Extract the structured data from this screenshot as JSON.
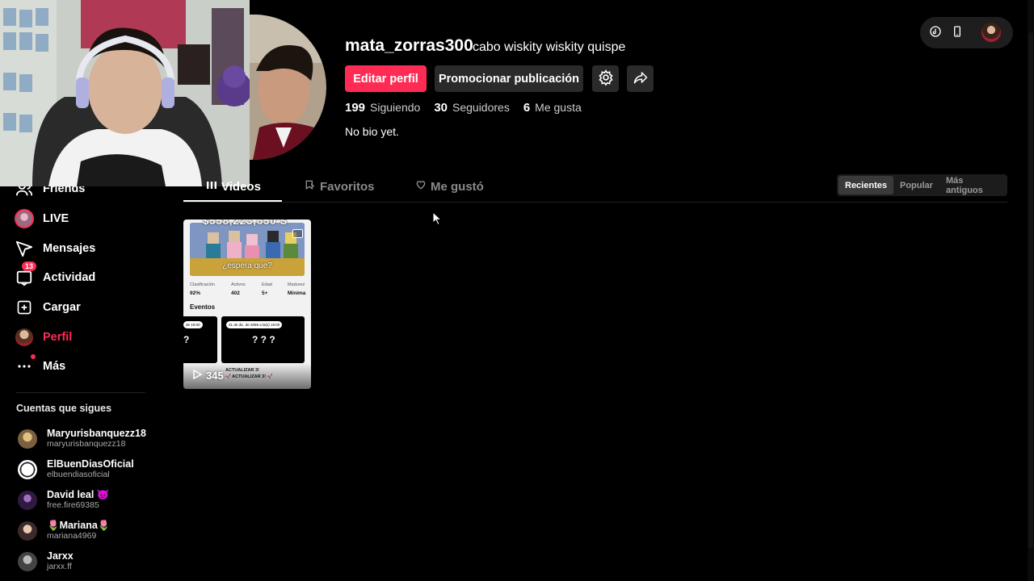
{
  "sidebar": {
    "items": [
      {
        "label": "Friends",
        "icon": "friends-icon"
      },
      {
        "label": "LIVE",
        "icon": "live-icon"
      },
      {
        "label": "Mensajes",
        "icon": "messages-icon"
      },
      {
        "label": "Actividad",
        "icon": "activity-icon",
        "badge": "13"
      },
      {
        "label": "Cargar",
        "icon": "upload-icon"
      },
      {
        "label": "Perfil",
        "icon": "profile-avatar-icon",
        "active": true
      },
      {
        "label": "Más",
        "icon": "more-icon"
      }
    ],
    "following_title": "Cuentas que sigues",
    "following": [
      {
        "name": "Maryurisbanquezz18",
        "handle": "maryurisbanquezz18"
      },
      {
        "name": "ElBuenDiasOficial",
        "handle": "elbuendiasoficial"
      },
      {
        "name": "David leal 👿",
        "handle": "free.fire69385"
      },
      {
        "name": "🌷Mariana🌷",
        "handle": "mariana4969"
      },
      {
        "name": "Jarxx",
        "handle": "jarxx.ff"
      }
    ]
  },
  "profile": {
    "username": "mata_zorras300",
    "nickname": "cabo wiskity wiskity quispe",
    "edit_label": "Editar perfil",
    "promote_label": "Promocionar publicación",
    "stats": {
      "following_count": "199",
      "following_label": "Siguiendo",
      "followers_count": "30",
      "followers_label": "Seguidores",
      "likes_count": "6",
      "likes_label": "Me gusta"
    },
    "bio": "No bio yet."
  },
  "tabs": [
    {
      "label": "Videos",
      "active": true
    },
    {
      "label": "Favoritos"
    },
    {
      "label": "Me gustó"
    }
  ],
  "sort": [
    "Recientes",
    "Popular",
    "Más antiguos"
  ],
  "video": {
    "views": "345",
    "overlay_top": "$558,223,650'S",
    "espera": "¿espera que?",
    "stats_labels": [
      "Clasificación",
      "Activos",
      "Edad",
      "Madurez"
    ],
    "stats_values": [
      "92%",
      "402",
      "5+",
      "Mínima"
    ],
    "eventos": "Eventos",
    "event_pill_1": "de 19:00",
    "event_pill_2": "31 de dic. de 2069 a la(s) 19:00",
    "event_q1": "?",
    "event_q2": "? ? ?",
    "update_text": "ACTUALIZAR 3!",
    "update_sub": "🚀 ACTUALIZAR 3! 🚀"
  },
  "colors": {
    "accent": "#fe2c55",
    "background": "#000000",
    "button_dark": "#2a2a2a"
  }
}
